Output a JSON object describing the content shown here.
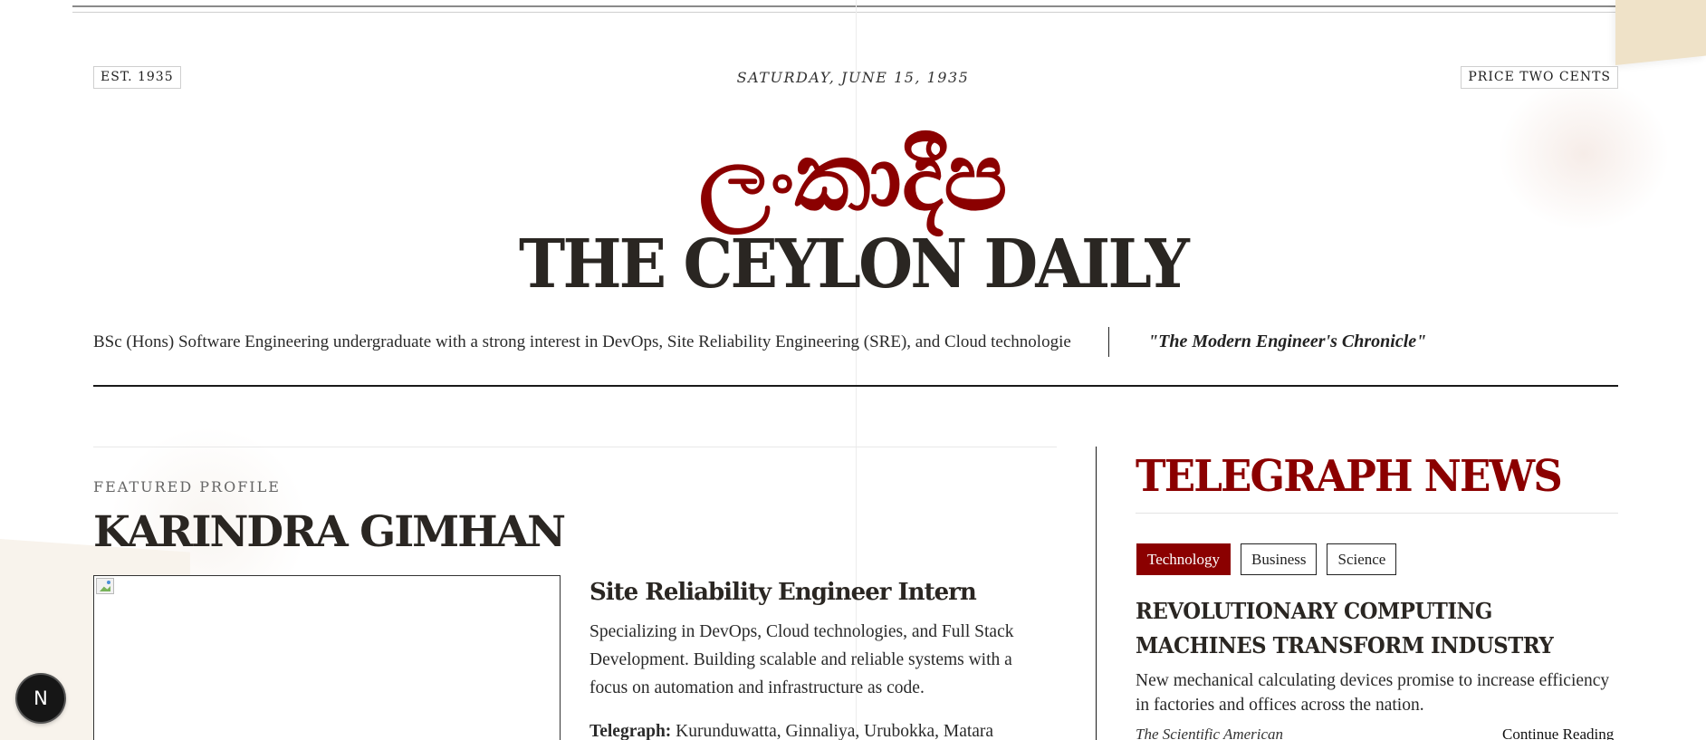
{
  "masthead": {
    "established": "EST. 1935",
    "date": "SATURDAY, JUNE 15, 1935",
    "price": "PRICE TWO CENTS",
    "title_sinhala": "ලංකාදීප",
    "title": "THE CEYLON DAILY",
    "ticker": "BSc (Hons) Software Engineering undergraduate with a strong interest in DevOps, Site Reliability Engineering (SRE), and Cloud technologies",
    "motto": "\"The Modern Engineer's Chronicle\""
  },
  "profile": {
    "kicker": "FEATURED PROFILE",
    "name": "KARINDRA GIMHAN",
    "role": "Site Reliability Engineer Intern",
    "summary": "Specializing in DevOps, Cloud technologies, and Full Stack Development. Building scalable and reliable systems with a focus on automation and infrastructure as code.",
    "telegraph_label": "Telegraph:",
    "telegraph_value": "Kurunduwatta, Ginnaliya, Urubokka, Matara"
  },
  "news": {
    "heading": "TELEGRAPH NEWS",
    "tabs": [
      {
        "label": "Technology",
        "active": true
      },
      {
        "label": "Business",
        "active": false
      },
      {
        "label": "Science",
        "active": false
      }
    ],
    "article": {
      "headline": "REVOLUTIONARY COMPUTING MACHINES TRANSFORM INDUSTRY",
      "blurb": "New mechanical calculating devices promise to increase efficiency in factories and offices across the nation.",
      "source": "The Scientific American",
      "cta": "Continue Reading"
    }
  },
  "floating_badge": {
    "label": "N"
  },
  "colors": {
    "accent": "#8b0000",
    "ink": "#2a2622",
    "paper": "#ffffff"
  }
}
